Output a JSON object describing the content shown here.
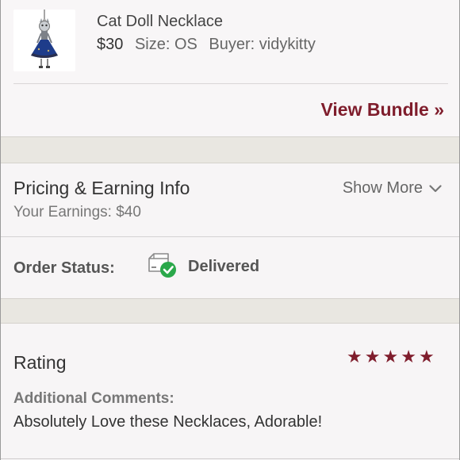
{
  "item": {
    "title": "Cat Doll Necklace",
    "price": "$30",
    "size": "Size: OS",
    "buyer": "Buyer: vidykitty",
    "view_bundle": "View Bundle »"
  },
  "pricing": {
    "title": "Pricing & Earning Info",
    "earnings": "Your Earnings: $40",
    "show_more": "Show More"
  },
  "order_status": {
    "label": "Order Status:",
    "value": "Delivered",
    "icon": "delivered-box-check-icon"
  },
  "rating": {
    "title": "Rating",
    "stars": 5,
    "max_stars": 5,
    "comments_label": "Additional Comments:",
    "comments_text": "Absolutely Love these Necklaces, Adorable!"
  },
  "colors": {
    "accent": "#7f1d2c",
    "status_green": "#2aa84a",
    "gap_gray": "#e9e7e1"
  }
}
